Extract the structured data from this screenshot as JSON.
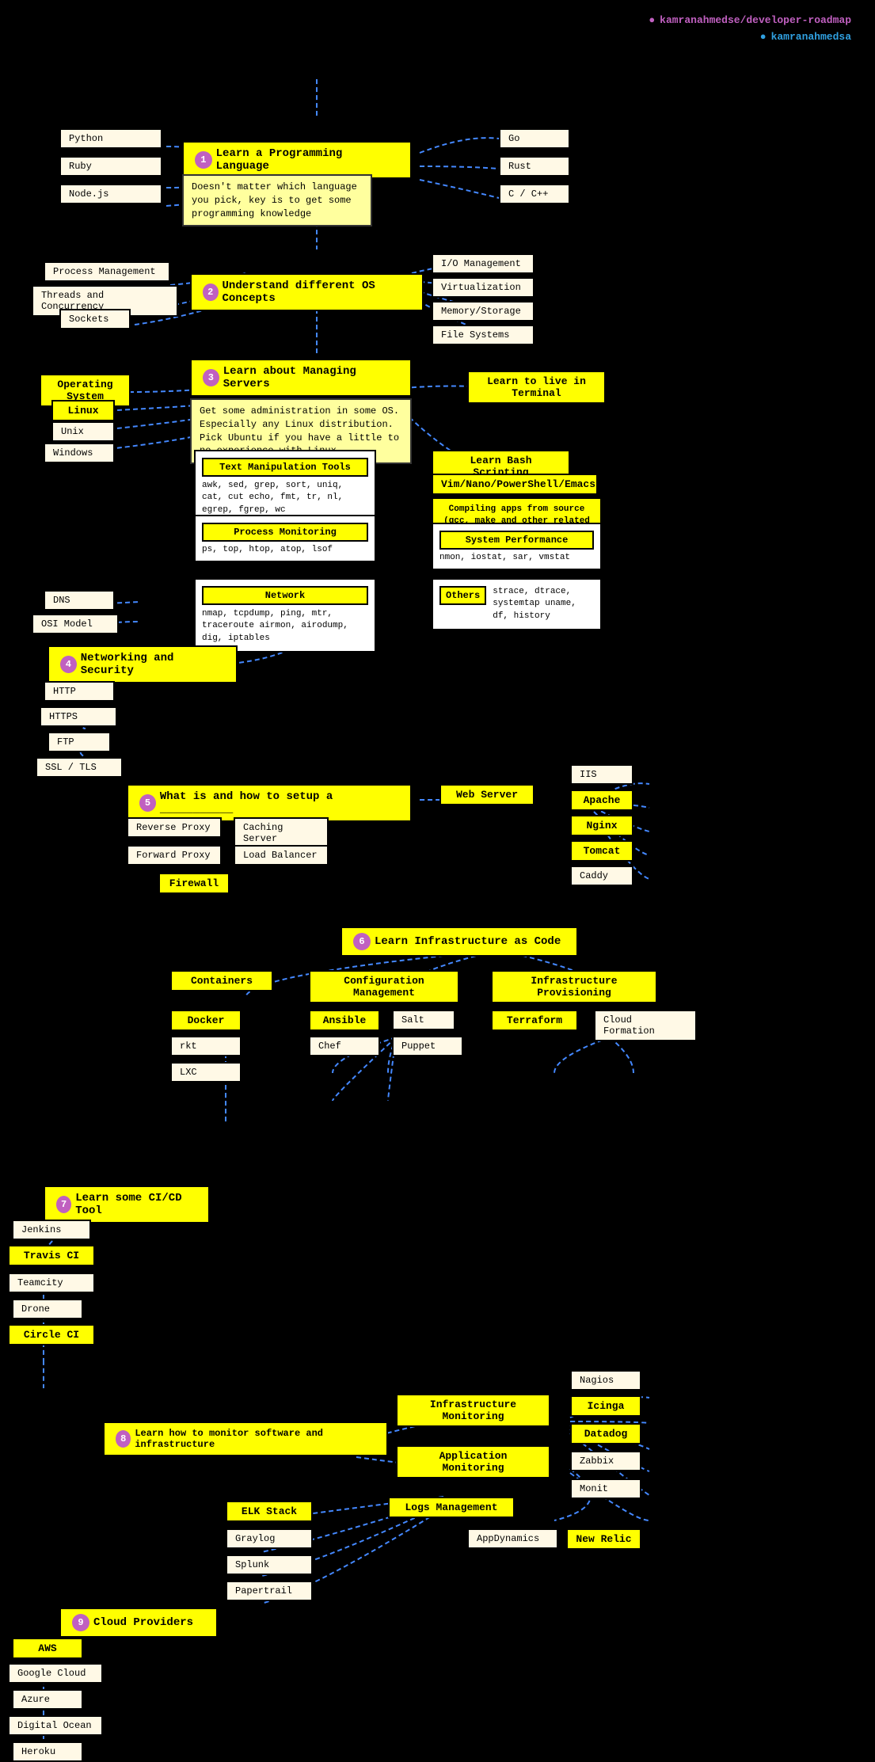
{
  "header": {
    "github_icon": "●",
    "github_text": "kamranahmedse/developer-roadmap",
    "twitter_icon": "●",
    "twitter_text": "kamranahmedsa"
  },
  "nodes": {
    "step1": "Learn a Programming Language",
    "step1_num": "1",
    "step1_desc": "Doesn't matter which language you pick, key is to get some programming knowledge",
    "python": "Python",
    "ruby": "Ruby",
    "nodejs": "Node.js",
    "go": "Go",
    "rust": "Rust",
    "cpp": "C / C++",
    "step2": "Understand different OS Concepts",
    "step2_num": "2",
    "process_mgmt": "Process Management",
    "threads": "Threads and Concurrency",
    "sockets": "Sockets",
    "io_mgmt": "I/O Management",
    "virtualization": "Virtualization",
    "memory": "Memory/Storage",
    "filesystems": "File Systems",
    "step3": "Learn about Managing Servers",
    "step3_num": "3",
    "step3_desc": "Get some administration in some OS. Especially any Linux distribution. Pick Ubuntu if you have a little to no experience with Linux.",
    "os": "Operating System",
    "linux": "Linux",
    "unix": "Unix",
    "windows": "Windows",
    "terminal": "Learn to live in Terminal",
    "text_tools_title": "Text Manipulation Tools",
    "text_tools_desc": "awk, sed, grep, sort, uniq, cat, cut echo, fmt, tr, nl, egrep, fgrep, wc",
    "bash": "Learn Bash Scripting",
    "vim": "Vim/Nano/PowerShell/Emacs",
    "compiling": "Compiling apps from source (gcc, make and other related stuff)",
    "proc_mon_title": "Process Monitoring",
    "proc_mon_desc": "ps, top, htop, atop, lsof",
    "sys_perf": "System Performance",
    "sys_perf_desc": "nmon, iostat, sar, vmstat",
    "network_title": "Network",
    "network_desc": "nmap, tcpdump, ping, mtr, traceroute airmon, airodump, dig, iptables",
    "others_title": "Others",
    "others_desc": "strace, dtrace, systemtap uname, df, history",
    "step4": "Networking and Security",
    "step4_num": "4",
    "dns": "DNS",
    "osi": "OSI Model",
    "http": "HTTP",
    "https": "HTTPS",
    "ftp": "FTP",
    "ssl": "SSL / TLS",
    "step5": "What is and how to setup a ___________",
    "step5_num": "5",
    "web_server": "Web Server",
    "iis": "IIS",
    "apache": "Apache",
    "nginx": "Nginx",
    "tomcat": "Tomcat",
    "caddy": "Caddy",
    "rev_proxy": "Reverse Proxy",
    "caching": "Caching Server",
    "fwd_proxy": "Forward Proxy",
    "lb": "Load Balancer",
    "firewall": "Firewall",
    "step6": "Learn Infrastructure as Code",
    "step6_num": "6",
    "containers": "Containers",
    "config_mgmt": "Configuration Management",
    "infra_prov": "Infrastructure Provisioning",
    "docker": "Docker",
    "rkt": "rkt",
    "lxc": "LXC",
    "ansible": "Ansible",
    "salt": "Salt",
    "chef": "Chef",
    "puppet": "Puppet",
    "terraform": "Terraform",
    "cloudformation": "Cloud Formation",
    "step7": "Learn some CI/CD Tool",
    "step7_num": "7",
    "jenkins": "Jenkins",
    "travis": "Travis CI",
    "teamcity": "Teamcity",
    "drone": "Drone",
    "circleci": "Circle CI",
    "step8": "Learn how to monitor software and infrastructure",
    "step8_num": "8",
    "infra_mon": "Infrastructure Monitoring",
    "app_mon": "Application Monitoring",
    "nagios": "Nagios",
    "icinga": "Icinga",
    "datadog": "Datadog",
    "zabbix": "Zabbix",
    "monit": "Monit",
    "logs_mgmt": "Logs Management",
    "elk": "ELK Stack",
    "graylog": "Graylog",
    "splunk": "Splunk",
    "papertrail": "Papertrail",
    "appdynamics": "AppDynamics",
    "newrelic": "New Relic",
    "step9": "Cloud Providers",
    "step9_num": "9",
    "aws": "AWS",
    "google_cloud": "Google Cloud",
    "azure": "Azure",
    "digital_ocean": "Digital Ocean",
    "heroku": "Heroku"
  }
}
